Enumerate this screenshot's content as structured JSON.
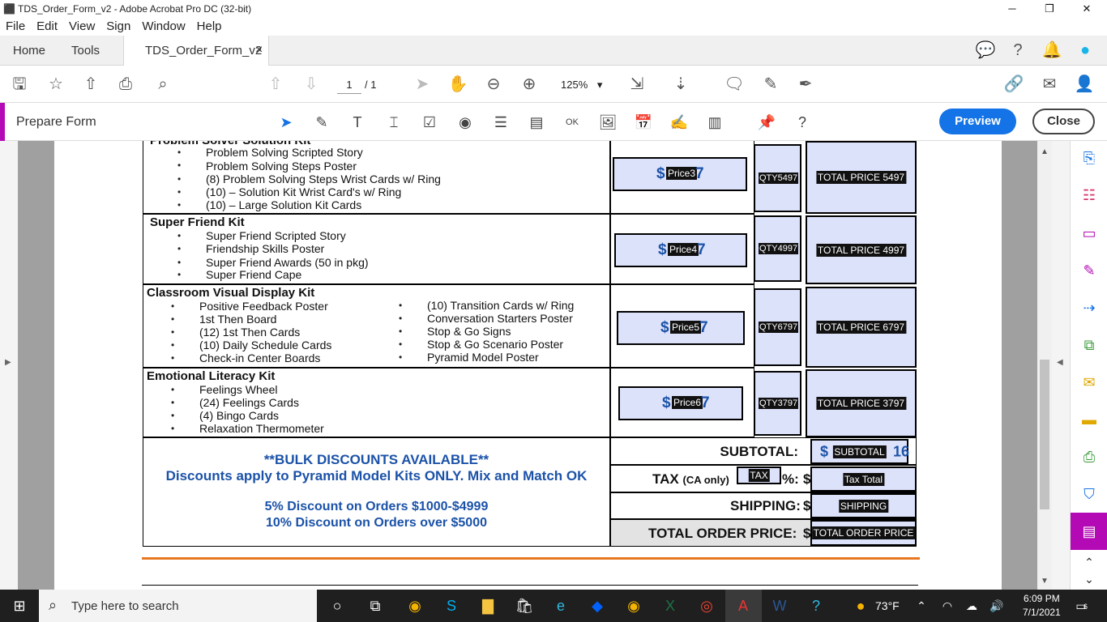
{
  "window": {
    "title": "TDS_Order_Form_v2 - Adobe Acrobat Pro DC (32-bit)",
    "minimize": "─",
    "restore": "❐",
    "close": "✕"
  },
  "menu": [
    "File",
    "Edit",
    "View",
    "Sign",
    "Window",
    "Help"
  ],
  "tabs": {
    "home": "Home",
    "tools": "Tools",
    "doc": "TDS_Order_Form_v2",
    "doc_close": "×"
  },
  "toolbar": {
    "page_current": "1",
    "page_total": "/ 1",
    "zoom": "125%",
    "zoom_caret": "▾"
  },
  "prepare": {
    "label": "Prepare Form",
    "preview": "Preview",
    "close": "Close"
  },
  "kits": [
    {
      "name": "Problem Solver Solution Kit",
      "items": [
        "Problem Solving Scripted Story",
        "Problem Solving Steps Poster",
        "(8) Problem Solving Steps Wrist Cards w/ Ring",
        "(10) – Solution Kit Wrist Card's w/ Ring",
        "(10) – Large Solution Kit Cards"
      ],
      "price_field": "Price3",
      "price_suffix": "7",
      "qty": "QTY5497",
      "total": "TOTAL PRICE 5497"
    },
    {
      "name": "Super Friend Kit",
      "items": [
        "Super Friend Scripted Story",
        "Friendship Skills Poster",
        "Super Friend Awards (50 in pkg)",
        "Super Friend Cape"
      ],
      "price_field": "Price4",
      "price_suffix": "7",
      "qty": "QTY4997",
      "total": "TOTAL PRICE 4997"
    },
    {
      "name": "Classroom Visual Display Kit",
      "items": [
        "Positive Feedback Poster",
        "1st Then Board",
        "(12) 1st Then Cards",
        "(10) Daily Schedule Cards",
        "Check-in Center Boards"
      ],
      "items2": [
        "(10) Transition Cards w/ Ring",
        "Conversation Starters Poster",
        "Stop & Go Signs",
        "Stop & Go Scenario Poster",
        "Pyramid Model Poster"
      ],
      "price_field": "Price5",
      "price_suffix": "7",
      "qty": "QTY6797",
      "total": "TOTAL PRICE 6797"
    },
    {
      "name": "Emotional Literacy Kit",
      "items": [
        "Feelings Wheel",
        "(24) Feelings Cards",
        "(4) Bingo Cards",
        "Relaxation Thermometer"
      ],
      "price_field": "Price6",
      "price_suffix": "7",
      "qty": "QTY3797",
      "total": "TOTAL PRICE 3797"
    }
  ],
  "currency": "$",
  "bullet": "•",
  "summary": {
    "subtotal_label": "SUBTOTAL:",
    "subtotal_field": "SUBTOTAL",
    "subtotal_suffix": "16",
    "tax_label": "TAX",
    "tax_sub": "(CA only)",
    "tax_field": "TAX",
    "tax_pct": "%:",
    "tax_total": "Tax Total",
    "shipping_label": "SHIPPING:",
    "shipping_field": "SHIPPING",
    "total_label": "TOTAL ORDER PRICE:",
    "total_field": "TOTAL ORDER PRICE"
  },
  "bulk": {
    "line1": "**BULK DISCOUNTS AVAILABLE**",
    "line2": "Discounts apply to Pyramid Model Kits ONLY. Mix and Match OK",
    "line3": "5% Discount on Orders $1000-$4999",
    "line4": "10% Discount on Orders over $5000"
  },
  "taskbar": {
    "search_placeholder": "Type here to search",
    "weather": "73°F",
    "time": "6:09 PM",
    "date": "7/1/2021",
    "notif_count": "6"
  },
  "colors": {
    "accent_blue": "#1473e6",
    "field_bg": "#dde2fb",
    "prepare_accent": "#b40ab5",
    "orange_rule": "#e87722"
  }
}
